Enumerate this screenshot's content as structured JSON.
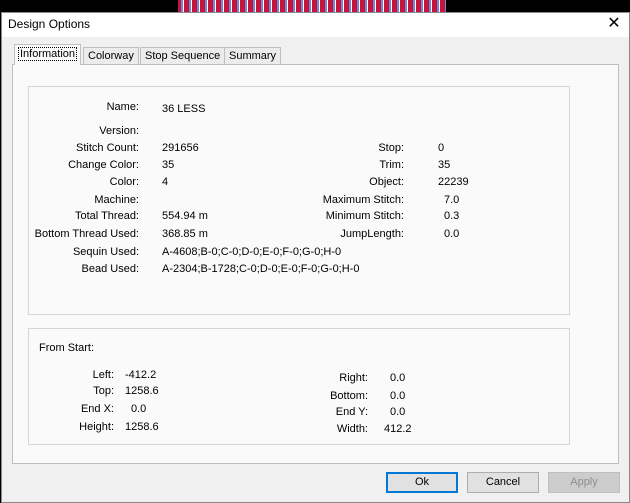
{
  "window": {
    "title": "Design Options"
  },
  "tabs": [
    "Information",
    "Colorway",
    "Stop Sequence",
    "Summary"
  ],
  "info": {
    "name_label": "Name:",
    "name": "36 LESS",
    "version_label": "Version:",
    "version": "",
    "stitch_count_label": "Stitch Count:",
    "stitch_count": "291656",
    "change_color_label": "Change Color:",
    "change_color": "35",
    "color_label": "Color:",
    "color": "4",
    "machine_label": "Machine:",
    "machine": "",
    "total_thread_label": "Total Thread:",
    "total_thread": "554.94 m",
    "bottom_thread_label": "Bottom Thread Used:",
    "bottom_thread": "368.85 m",
    "sequin_label": "Sequin Used:",
    "sequin": "A-4608;B-0;C-0;D-0;E-0;F-0;G-0;H-0",
    "bead_label": "Bead Used:",
    "bead": "A-2304;B-1728;C-0;D-0;E-0;F-0;G-0;H-0",
    "stop_label": "Stop:",
    "stop": "0",
    "trim_label": "Trim:",
    "trim": "35",
    "object_label": "Object:",
    "object": "22239",
    "max_stitch_label": "Maximum Stitch:",
    "max_stitch": "7.0",
    "min_stitch_label": "Minimum Stitch:",
    "min_stitch": "0.3",
    "jump_length_label": "JumpLength:",
    "jump_length": "0.0"
  },
  "from_start": {
    "heading": "From Start:",
    "left_label": "Left:",
    "left": "-412.2",
    "top_label": "Top:",
    "top": "1258.6",
    "endx_label": "End X:",
    "endx": "0.0",
    "height_label": "Height:",
    "height": "1258.6",
    "right_label": "Right:",
    "right": "0.0",
    "bottom_label": "Bottom:",
    "bottom": "0.0",
    "endy_label": "End Y:",
    "endy": "0.0",
    "width_label": "Width:",
    "width": "412.2"
  },
  "buttons": {
    "ok": "Ok",
    "cancel": "Cancel",
    "apply": "Apply"
  }
}
